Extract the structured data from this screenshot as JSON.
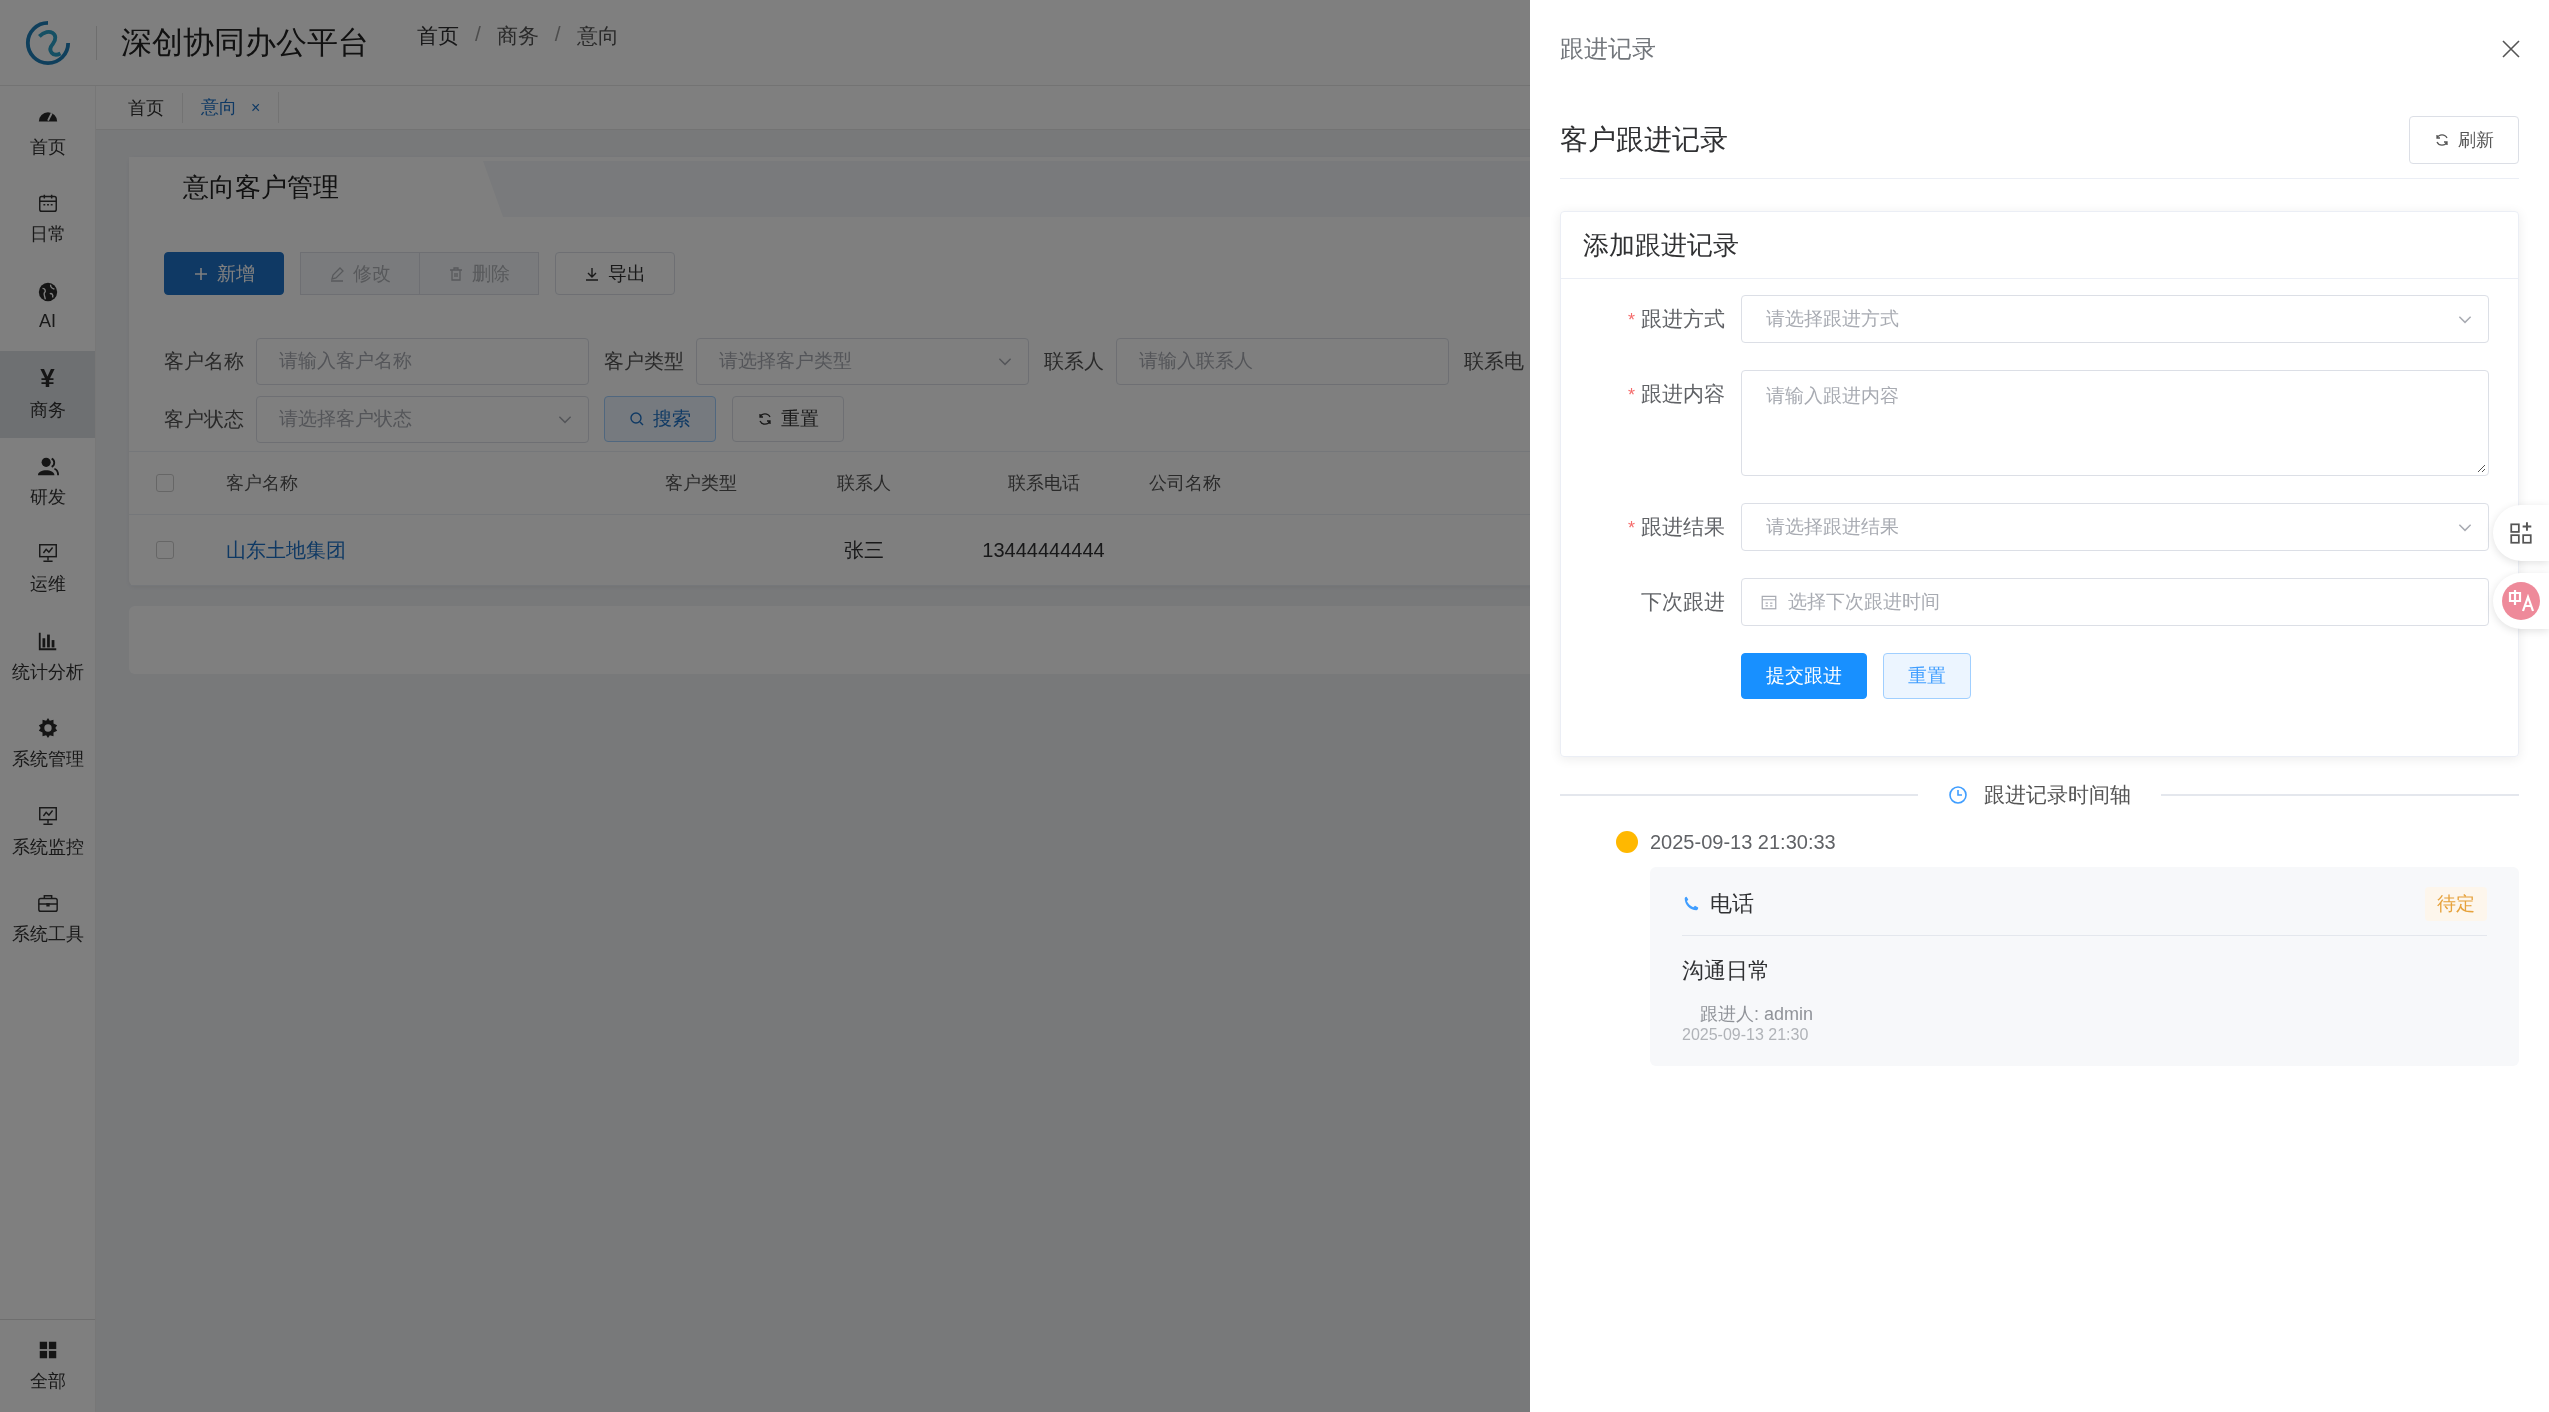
{
  "app": {
    "title": "深创协同办公平台",
    "breadcrumb": [
      "首页",
      "商务",
      "意向"
    ],
    "breadcrumb_separator": "/"
  },
  "sidebar": {
    "items": [
      {
        "label": "首页",
        "selected": false
      },
      {
        "label": "日常",
        "selected": false
      },
      {
        "label": "AI",
        "selected": false
      },
      {
        "label": "商务",
        "glyph": "¥",
        "selected": true
      },
      {
        "label": "研发",
        "selected": false
      },
      {
        "label": "运维",
        "selected": false
      },
      {
        "label": "统计分析",
        "selected": false
      },
      {
        "label": "系统管理",
        "selected": false
      },
      {
        "label": "系统监控",
        "selected": false
      },
      {
        "label": "系统工具",
        "selected": false
      }
    ],
    "bottom_item": {
      "label": "全部"
    }
  },
  "tabs": [
    {
      "label": "首页",
      "selected": false
    },
    {
      "label": "意向",
      "selected": true,
      "close": "×"
    }
  ],
  "page": {
    "title": "意向客户管理",
    "toolbar": [
      {
        "label": "新增",
        "kind": "primary",
        "disabled": false
      },
      {
        "label": "修改",
        "kind": "group",
        "disabled": true
      },
      {
        "label": "删除",
        "kind": "group",
        "disabled": true
      },
      {
        "label": "导出",
        "kind": "default",
        "disabled": false
      }
    ],
    "filter_rows": [
      [
        {
          "label": "客户名称",
          "kind": "input",
          "placeholder": "请输入客户名称"
        },
        {
          "label": "客户类型",
          "kind": "select",
          "placeholder": "请选择客户类型"
        },
        {
          "label": "联系人",
          "kind": "input",
          "placeholder": "请输入联系人"
        },
        {
          "label": "联系电",
          "kind": "label"
        }
      ],
      [
        {
          "label": "客户状态",
          "kind": "select",
          "placeholder": "请选择客户状态"
        },
        {
          "label": "搜索",
          "kind": "search_button"
        },
        {
          "label": "重置",
          "kind": "reset_button"
        }
      ]
    ],
    "table": {
      "columns": [
        "客户名称",
        "客户类型",
        "联系人",
        "联系电话",
        "公司名称"
      ],
      "all_checked": false,
      "rows": [
        {
          "customer_name": "山东土地集团",
          "contact": "张三",
          "phone": "13444444444",
          "checked": false
        }
      ]
    }
  },
  "drawer": {
    "title": "跟进记录",
    "heading": "客户跟进记录",
    "refresh_button": "刷新",
    "form": {
      "title": "添加跟进记录",
      "fields": [
        {
          "label": "跟进方式",
          "required_mark": "*",
          "kind": "select",
          "placeholder": "请选择跟进方式"
        },
        {
          "label": "跟进内容",
          "required_mark": "*",
          "kind": "textarea",
          "placeholder": "请输入跟进内容"
        },
        {
          "label": "跟进结果",
          "required_mark": "*",
          "kind": "select",
          "placeholder": "请选择跟进结果"
        },
        {
          "label": "下次跟进",
          "kind": "date",
          "placeholder": "选择下次跟进时间"
        }
      ],
      "buttons": [
        {
          "label": "提交跟进",
          "kind": "primary"
        },
        {
          "label": "重置",
          "kind": "plain"
        }
      ]
    },
    "timeline": {
      "title": "跟进记录时间轴",
      "items": [
        {
          "time": "2025-09-13 21:30:33",
          "color": "#ffb800",
          "method": "电话",
          "status": "待定",
          "content": "沟通日常",
          "follower": "跟进人: admin",
          "created": "2025-09-13 21:30"
        }
      ]
    }
  }
}
